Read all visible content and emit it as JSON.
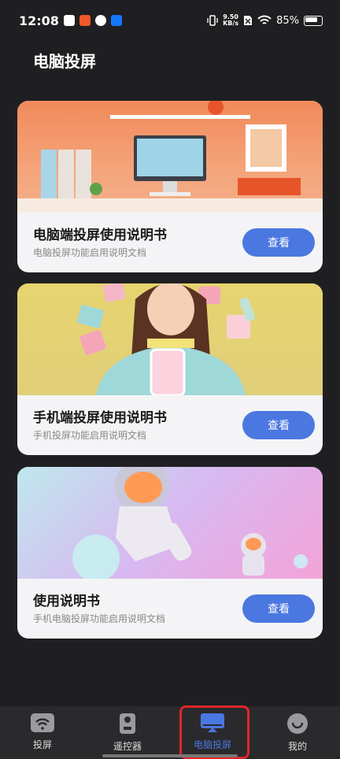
{
  "status": {
    "time": "12:08",
    "net_speed_value": "9.50",
    "net_speed_unit": "KB/s",
    "battery": "85%"
  },
  "page": {
    "title": "电脑投屏"
  },
  "cards": [
    {
      "title": "电脑端投屏使用说明书",
      "subtitle": "电脑投屏功能启用说明文档",
      "button": "查看"
    },
    {
      "title": "手机端投屏使用说明书",
      "subtitle": "手机投屏功能启用说明文档",
      "button": "查看"
    },
    {
      "title": "使用说明书",
      "subtitle": "手机电脑投屏功能启用说明文档",
      "button": "查看"
    }
  ],
  "nav": {
    "items": [
      {
        "label": "投屏"
      },
      {
        "label": "遥控器"
      },
      {
        "label": "电脑投屏"
      },
      {
        "label": "我的"
      }
    ],
    "active_color": "#4b77e0"
  }
}
